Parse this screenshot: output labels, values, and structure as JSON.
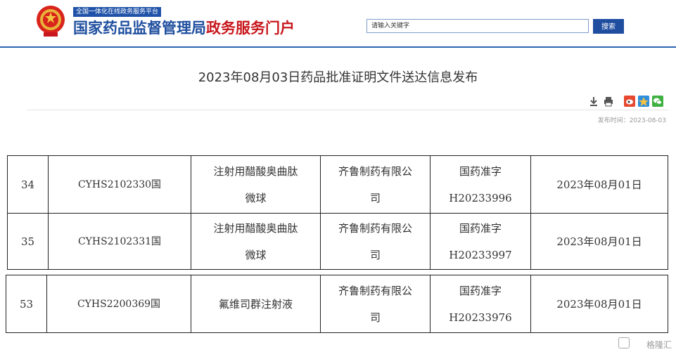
{
  "header": {
    "subtitle": "全国一体化在线政务服务平台",
    "logo_main": "国家药品监督管理局",
    "logo_accent": "政务服务门户",
    "search_placeholder": "请输入关键字",
    "search_button": "搜索"
  },
  "article": {
    "title": "2023年08月03日药品批准证明文件送达信息发布",
    "publish_date": "发布时间：2023-08-03"
  },
  "table_a": {
    "rows": [
      {
        "no": "34",
        "code": "CYHS2102330国",
        "name_l1": "注射用醋酸奥曲肽",
        "name_l2": "微球",
        "company_l1": "齐鲁制药有限公",
        "company_l2": "司",
        "approval_l1": "国药准字",
        "approval_l2": "H20233996",
        "date": "2023年08月01日"
      },
      {
        "no": "35",
        "code": "CYHS2102331国",
        "name_l1": "注射用醋酸奥曲肽",
        "name_l2": "微球",
        "company_l1": "齐鲁制药有限公",
        "company_l2": "司",
        "approval_l1": "国药准字",
        "approval_l2": "H20233997",
        "date": "2023年08月01日"
      }
    ]
  },
  "table_b": {
    "rows": [
      {
        "no": "53",
        "code": "CYHS2200369国",
        "name": "氟维司群注射液",
        "company_l1": "齐鲁制药有限公",
        "company_l2": "司",
        "approval_l1": "国药准字",
        "approval_l2": "H20233976",
        "date": "2023年08月01日"
      }
    ]
  },
  "icons": [
    "download-icon",
    "print-icon",
    "weibo-icon",
    "qzone-icon",
    "wechat-icon"
  ],
  "watermark": "格隆汇",
  "colors": {
    "brand_blue": "#1f4f9f",
    "brand_red": "#c8171d",
    "header_line": "#2d64b3"
  }
}
